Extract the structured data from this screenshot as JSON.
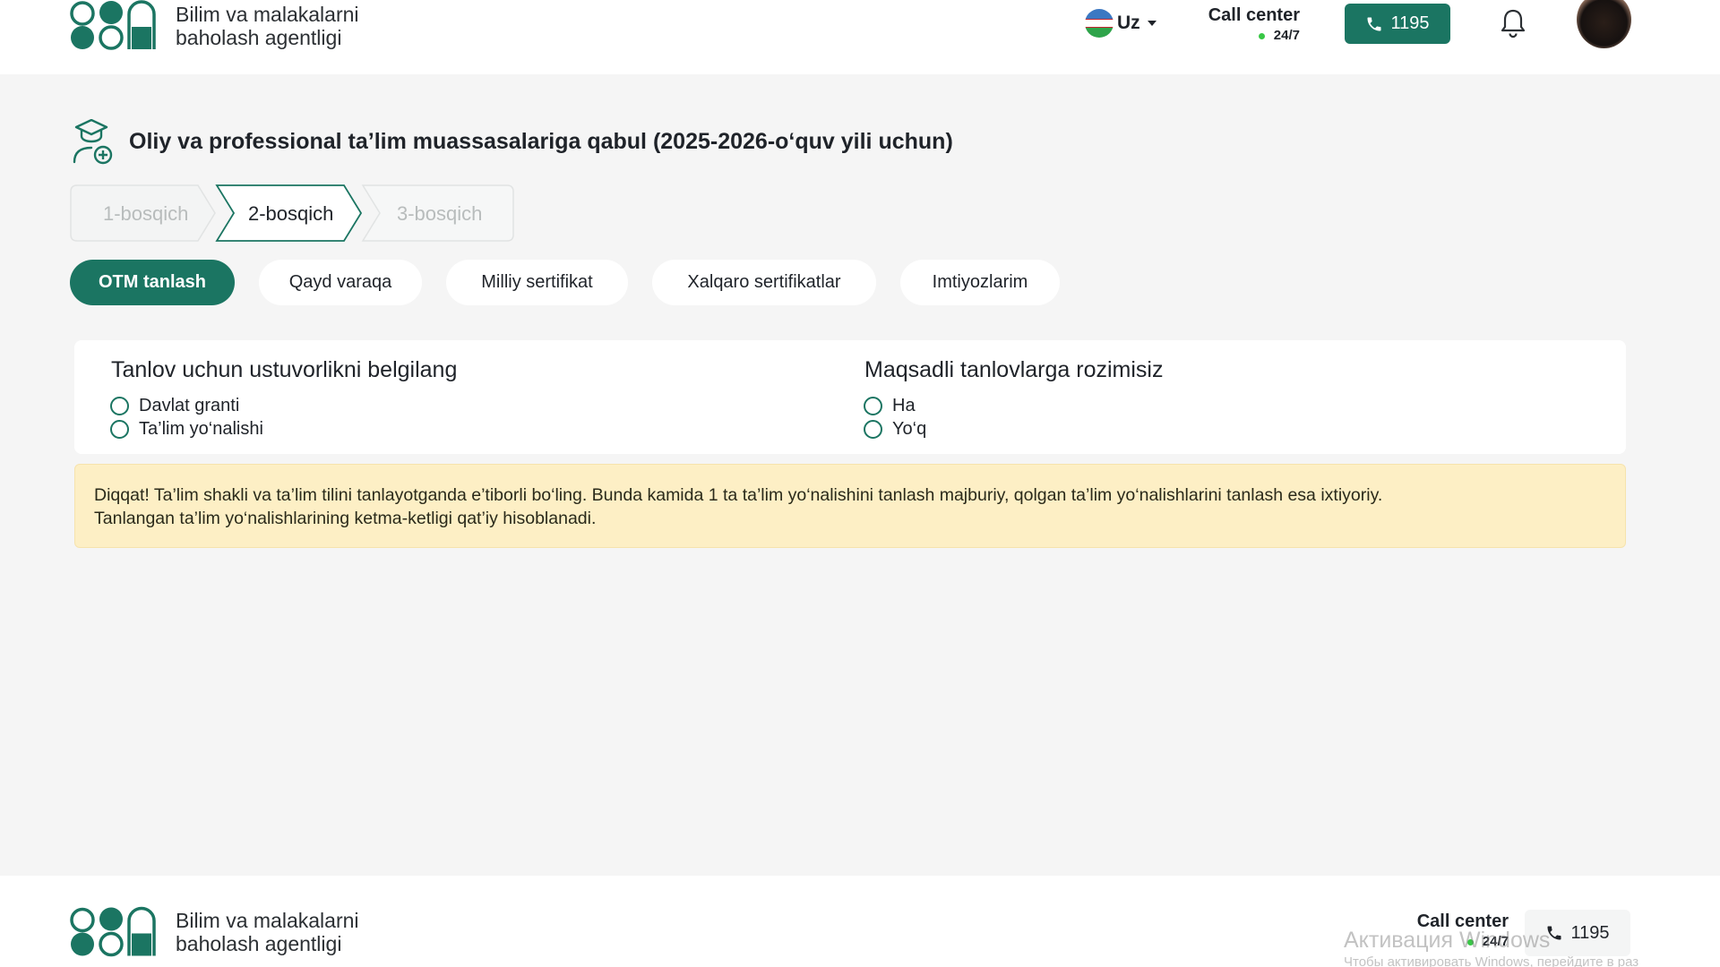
{
  "header": {
    "logo_line1": "Bilim va malakalarni",
    "logo_line2": "baholash agentligi",
    "language": "Uz",
    "call_center_title": "Call center",
    "call_center_hours": "24/7",
    "phone_number": "1195"
  },
  "page": {
    "title": "Oliy va professional ta’lim muassasalariga qabul (2025-2026-o‘quv yili uchun)"
  },
  "stepper": {
    "steps": [
      {
        "label": "1-bosqich",
        "state": "done"
      },
      {
        "label": "2-bosqich",
        "state": "active"
      },
      {
        "label": "3-bosqich",
        "state": "upcoming"
      }
    ]
  },
  "tabs": [
    {
      "label": "OTM tanlash",
      "active": true
    },
    {
      "label": "Qayd varaqa",
      "active": false
    },
    {
      "label": "Milliy sertifikat",
      "active": false
    },
    {
      "label": "Xalqaro sertifikatlar",
      "active": false
    },
    {
      "label": "Imtiyozlarim",
      "active": false
    }
  ],
  "priority": {
    "title": "Tanlov uchun ustuvorlikni belgilang",
    "options": [
      "Davlat granti",
      "Ta’lim yo‘nalishi"
    ]
  },
  "targeted": {
    "title": "Maqsadli tanlovlarga rozimisiz",
    "options": [
      "Ha",
      "Yo‘q"
    ]
  },
  "notice": {
    "line1": "Diqqat! Ta’lim shakli va ta’lim tilini tanlayotganda e’tiborli bo‘ling. Bunda kamida 1 ta ta’lim yo‘nalishini tanlash majburiy, qolgan ta’lim yo‘nalishlarini tanlash esa ixtiyoriy.",
    "line2": "Tanlangan ta’lim yo‘nalishlarining ketma-ketligi qat’iy hisoblanadi."
  },
  "footer": {
    "logo_line1": "Bilim va malakalarni",
    "logo_line2": "baholash agentligi",
    "call_center_title": "Call center",
    "call_center_hours": "24/7",
    "phone_number": "1195"
  },
  "watermark": {
    "line1": "Активация Windows",
    "line2": "Чтобы активировать Windows, перейдите в раз"
  },
  "colors": {
    "primary": "#1b7562",
    "background": "#f5f5f5",
    "notice_bg": "#fdefc5",
    "status_dot": "#38c745"
  }
}
